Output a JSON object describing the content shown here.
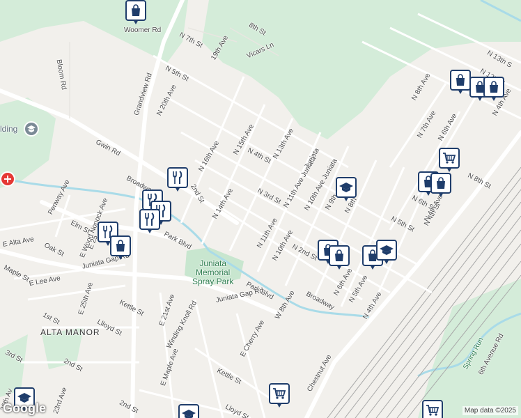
{
  "map": {
    "place_label": "ALTA MANOR",
    "park_label_line1": "Juniata",
    "park_label_line2": "Memorial",
    "park_label_line3": "Spray Park",
    "poi_label_building": "lding",
    "street_labels": {
      "woomer": "Woomer Rd",
      "n7th": "N 7th St",
      "n8th_top": "8th St",
      "n19th": "19th Ave",
      "vicars": "Vicars Ln",
      "n13th_tr": "N 13th S",
      "n12th_tr": "N 12th S",
      "bloom": "Bloom Rd",
      "n5th_top": "N 5th St",
      "n20th": "N 20th Ave",
      "grandview": "Grandview Rd",
      "gwin": "Gwin Rd",
      "n16th": "N 16th Ave",
      "n15th": "N 15th Ave",
      "n4th": "N 4th St",
      "n13th": "N 13th Ave",
      "juniata1": "Juniata",
      "juniata2": "N 11th Ave Juniata",
      "juniata3": "N 10th Ave Juniata",
      "broadway_top": "Broadway",
      "n2nd_left": "2nd St",
      "n14th": "N 14th Ave",
      "n3rd": "N 3rd St",
      "n9th": "N 9th",
      "n8th_mid": "N 8th",
      "n6th_r": "N 6th St",
      "n4th_r": "N 4th St",
      "n5th_r": "N 5th St",
      "n8th_r": "N 8th St",
      "n8th_ave": "N 8th Ave",
      "n7th_ave": "N 7th Ave",
      "n6th_ave": "N 6th Ave",
      "n11th": "N 11th Ave",
      "n10th": "N 10th Ave",
      "n2nd": "N 2nd St",
      "park_blvd": "Park Blvd",
      "park_blvd2": "Park Blvd",
      "penway": "Penway Ave",
      "e_woodlonock": "E Wood Nonock Ave",
      "e25": "E 25",
      "elm": "Elm St",
      "e_alta": "E Alta Ave",
      "oak": "Oak St",
      "maple": "Maple St",
      "juniata_gap": "Juniata Gap Rd",
      "e_lee": "E Lee Ave",
      "e25th": "E 25th Ave",
      "kettle": "Kettle St",
      "e21st": "E 21st Ave",
      "winding": "Winding Knoll Rd",
      "juniata_gap2": "Juniata Gap Rd",
      "n8th_ave2": "W 8th Ave",
      "broadway2": "Broadway",
      "n6th_ave2": "N 6th Ave",
      "n5th_ave": "N 5th Ave",
      "n4th_ave_low": "N 4th Ave",
      "n4th_ave_r": "N 4th Ave",
      "n4th_ave_r2": "N 4th Ave",
      "first": "1st St",
      "lloyd": "Llloyd St",
      "third": "3rd St",
      "second": "2nd St",
      "e_maple": "E Maple Ave",
      "kettle2": "Kettle St",
      "e_cherry": "E Cherry Ave",
      "chestnut": "Chestnut Ave",
      "second2": "2nd St",
      "lloyd2": "Lloyd St",
      "n23rd": "23rd Ave",
      "n26th": "26th Av",
      "spring": "Spring Run",
      "sixth_ave": "6th Avenue Rd"
    },
    "credit": "Map data ©2025",
    "logo": "Google"
  },
  "colors": {
    "marker_border": "#1f3d6b",
    "road": "#ffffff",
    "green": "#d4ecd9",
    "water": "#a9dbe8",
    "rail": "#9a9a9a"
  },
  "markers": [
    {
      "kind": "shopping-bag-icon"
    },
    {
      "kind": "shopping-bag-icon"
    },
    {
      "kind": "shopping-bag-icon"
    },
    {
      "kind": "shopping-bag-icon"
    },
    {
      "kind": "grocery-cart-icon"
    },
    {
      "kind": "shopping-bag-icon"
    },
    {
      "kind": "shopping-bag-icon"
    },
    {
      "kind": "school-icon"
    },
    {
      "kind": "restaurant-icon"
    },
    {
      "kind": "restaurant-icon"
    },
    {
      "kind": "restaurant-icon"
    },
    {
      "kind": "restaurant-icon"
    },
    {
      "kind": "restaurant-icon"
    },
    {
      "kind": "shopping-bag-icon"
    },
    {
      "kind": "shopping-bag-icon"
    },
    {
      "kind": "shopping-bag-icon"
    },
    {
      "kind": "shopping-bag-icon"
    },
    {
      "kind": "school-icon"
    },
    {
      "kind": "grocery-cart-icon"
    },
    {
      "kind": "school-icon"
    },
    {
      "kind": "school-icon"
    },
    {
      "kind": "grocery-cart-icon"
    }
  ]
}
